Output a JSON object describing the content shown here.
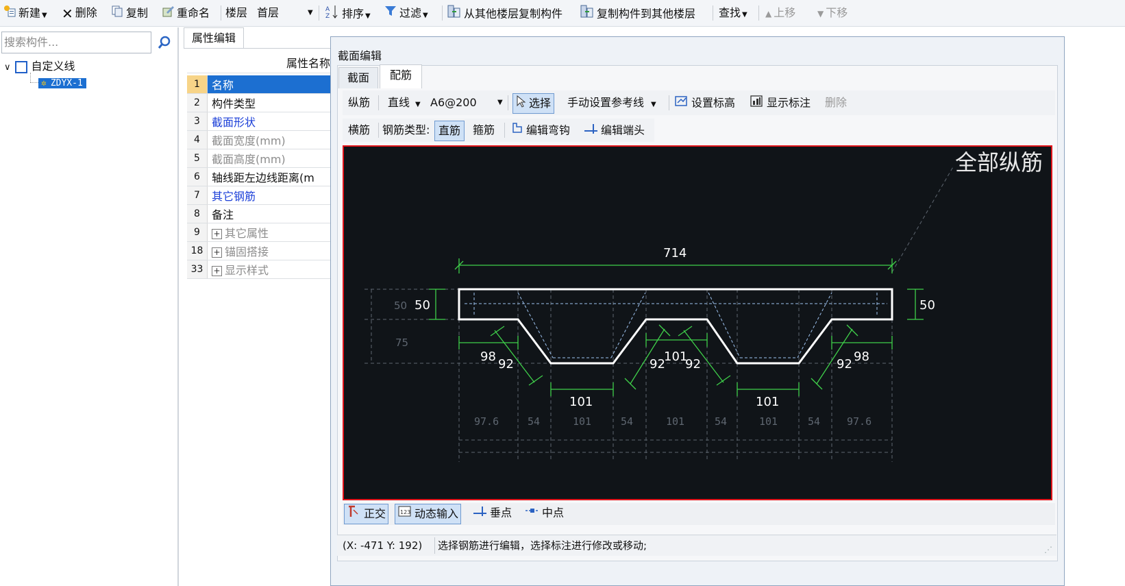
{
  "toolbar": {
    "new": "新建",
    "delete": "删除",
    "copy": "复制",
    "rename": "重命名",
    "floor_label": "楼层",
    "floor_value": "首层",
    "sort": "排序",
    "filter": "过滤",
    "copy_from_floor": "从其他楼层复制构件",
    "copy_to_floor": "复制构件到其他楼层",
    "find": "查找",
    "move_up": "上移",
    "move_down": "下移"
  },
  "search": {
    "placeholder": "搜索构件..."
  },
  "tree": {
    "root": "自定义线",
    "child": "ZDYX-1"
  },
  "properties": {
    "tab": "属性编辑",
    "header": "属性名称",
    "rows": [
      {
        "num": "1",
        "name": "名称"
      },
      {
        "num": "2",
        "name": "构件类型"
      },
      {
        "num": "3",
        "name": "截面形状"
      },
      {
        "num": "4",
        "name": "截面宽度(mm)"
      },
      {
        "num": "5",
        "name": "截面高度(mm)"
      },
      {
        "num": "6",
        "name": "轴线距左边线距离(m"
      },
      {
        "num": "7",
        "name": "其它钢筋"
      },
      {
        "num": "8",
        "name": "备注"
      },
      {
        "num": "9",
        "name": "其它属性"
      },
      {
        "num": "18",
        "name": "锚固搭接"
      },
      {
        "num": "33",
        "name": "显示样式"
      }
    ]
  },
  "dialog": {
    "title": "截面编辑",
    "tabs": [
      "截面",
      "配筋"
    ],
    "bar1": {
      "longitudinal": "纵筋",
      "line_type": "直线",
      "spec": "A6@200",
      "select": "选择",
      "manual_ref": "手动设置参考线",
      "set_elevation": "设置标高",
      "show_labels": "显示标注",
      "delete": "删除"
    },
    "bar2": {
      "transverse": "横筋",
      "rebar_type_label": "钢筋类型:",
      "straight": "直筋",
      "stirrup": "箍筋",
      "edit_hook": "编辑弯钩",
      "edit_end": "编辑端头"
    },
    "canvas": {
      "all_longitudinal": "全部纵筋",
      "dim_total": "714",
      "dim_50_left_small": "50",
      "dim_50_left": "50",
      "dim_50_right": "50",
      "dim_75": "75",
      "dim_98_left": "98",
      "dim_92_left": "92",
      "dim_101_mid_left": "101",
      "dim_92_mid_a": "92",
      "dim_101_mid_top": "101",
      "dim_92_mid_b": "92",
      "dim_101_mid_right": "101",
      "dim_92_right": "92",
      "dim_98_right": "98",
      "bottom_dims": [
        "97.6",
        "54",
        "101",
        "54",
        "101",
        "54",
        "101",
        "54",
        "97.6"
      ]
    },
    "bottom": {
      "ortho": "正交",
      "dynamic_input": "动态输入",
      "perpendicular": "垂点",
      "midpoint": "中点"
    },
    "status": {
      "coords": "(X: -471 Y: 192)",
      "message": "选择钢筋进行编辑，选择标注进行修改或移动;"
    }
  }
}
